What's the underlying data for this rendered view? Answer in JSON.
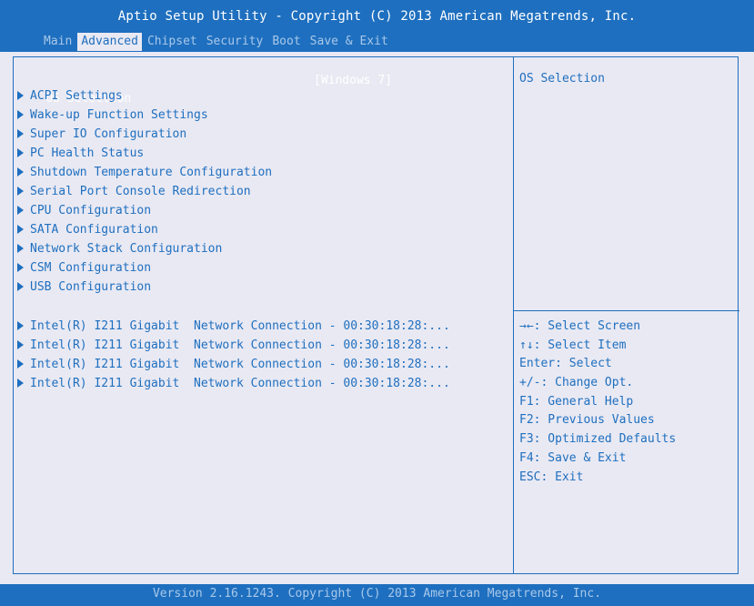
{
  "header": {
    "title": "Aptio Setup Utility - Copyright (C) 2013 American Megatrends, Inc.",
    "tabs": [
      {
        "label": "Main"
      },
      {
        "label": "Advanced"
      },
      {
        "label": "Chipset"
      },
      {
        "label": "Security"
      },
      {
        "label": "Boot"
      },
      {
        "label": "Save & Exit"
      }
    ],
    "active_tab": "Advanced"
  },
  "main": {
    "os_selection": {
      "label": "OS Selection",
      "value": "[Windows 7]"
    },
    "items": [
      {
        "label": "ACPI Settings"
      },
      {
        "label": "Wake-up Function Settings"
      },
      {
        "label": "Super IO Configuration"
      },
      {
        "label": "PC Health Status"
      },
      {
        "label": "Shutdown Temperature Configuration"
      },
      {
        "label": "Serial Port Console Redirection"
      },
      {
        "label": "CPU Configuration"
      },
      {
        "label": "SATA Configuration"
      },
      {
        "label": "Network Stack Configuration"
      },
      {
        "label": "CSM Configuration"
      },
      {
        "label": "USB Configuration"
      }
    ],
    "network_items": [
      {
        "label": "Intel(R) I211 Gigabit  Network Connection - 00:30:18:28:..."
      },
      {
        "label": "Intel(R) I211 Gigabit  Network Connection - 00:30:18:28:..."
      },
      {
        "label": "Intel(R) I211 Gigabit  Network Connection - 00:30:18:28:..."
      },
      {
        "label": "Intel(R) I211 Gigabit  Network Connection - 00:30:18:28:..."
      }
    ]
  },
  "help": {
    "description": "OS Selection",
    "keys": [
      "→←: Select Screen",
      "↑↓: Select Item",
      "Enter: Select",
      "+/-: Change Opt.",
      "F1: General Help",
      "F2: Previous Values",
      "F3: Optimized Defaults",
      "F4: Save & Exit",
      "ESC: Exit"
    ]
  },
  "footer": {
    "version": "Version 2.16.1243. Copyright (C) 2013 American Megatrends, Inc."
  },
  "colors": {
    "accent": "#1e6fbf",
    "background": "#e9e9f3",
    "highlight_text": "#ffffff"
  }
}
